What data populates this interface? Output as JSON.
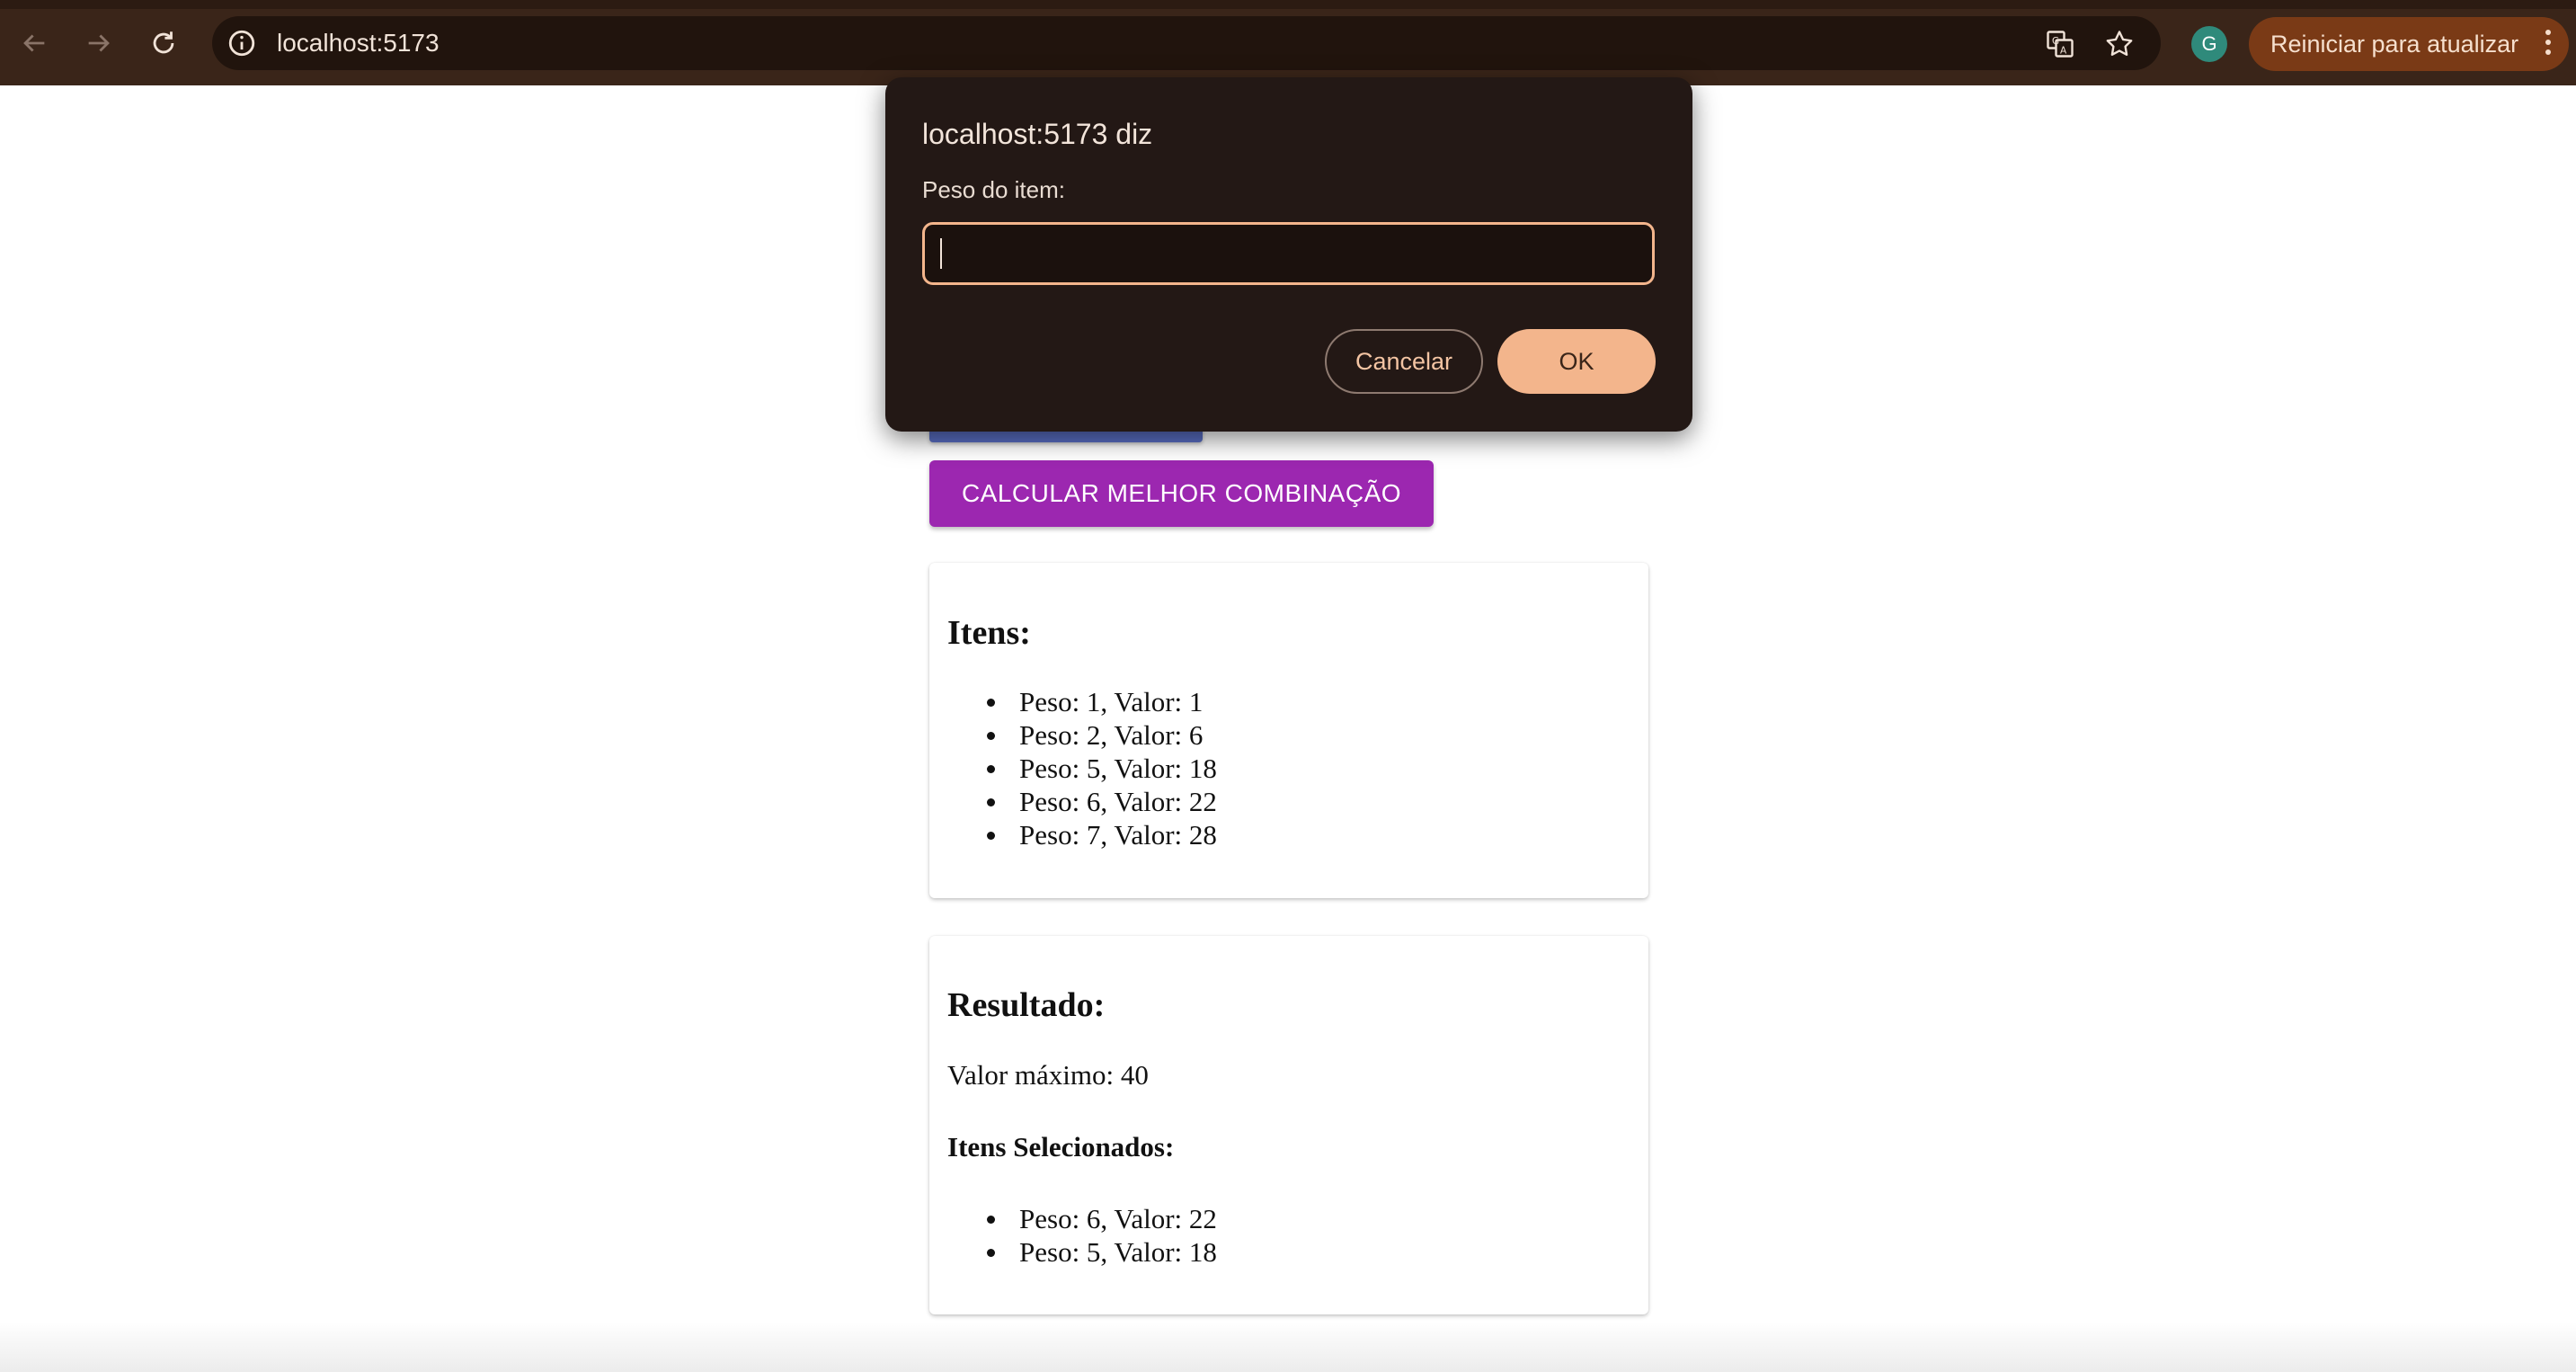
{
  "browser": {
    "url": "localhost:5173",
    "update_button_label": "Reiniciar para atualizar",
    "profile_initial": "G"
  },
  "page": {
    "calc_button_label": "CALCULAR MELHOR COMBINAÇÃO",
    "items_card": {
      "title": "Itens:",
      "items": [
        "Peso: 1, Valor: 1",
        "Peso: 2, Valor: 6",
        "Peso: 5, Valor: 18",
        "Peso: 6, Valor: 22",
        "Peso: 7, Valor: 28"
      ]
    },
    "result_card": {
      "title": "Resultado:",
      "max_value": "Valor máximo: 40",
      "selected_title": "Itens Selecionados:",
      "selected": [
        "Peso: 6, Valor: 22",
        "Peso: 5, Valor: 18"
      ]
    }
  },
  "dialog": {
    "title": "localhost:5173 diz",
    "label": "Peso do item:",
    "input_value": "",
    "cancel_label": "Cancelar",
    "ok_label": "OK"
  },
  "colors": {
    "chrome_bg": "#3a2519",
    "dialog_bg": "#231815",
    "dialog_accent": "#f3b58c",
    "calc_button": "#9c27b0",
    "blue_button": "#5a6fc4"
  }
}
